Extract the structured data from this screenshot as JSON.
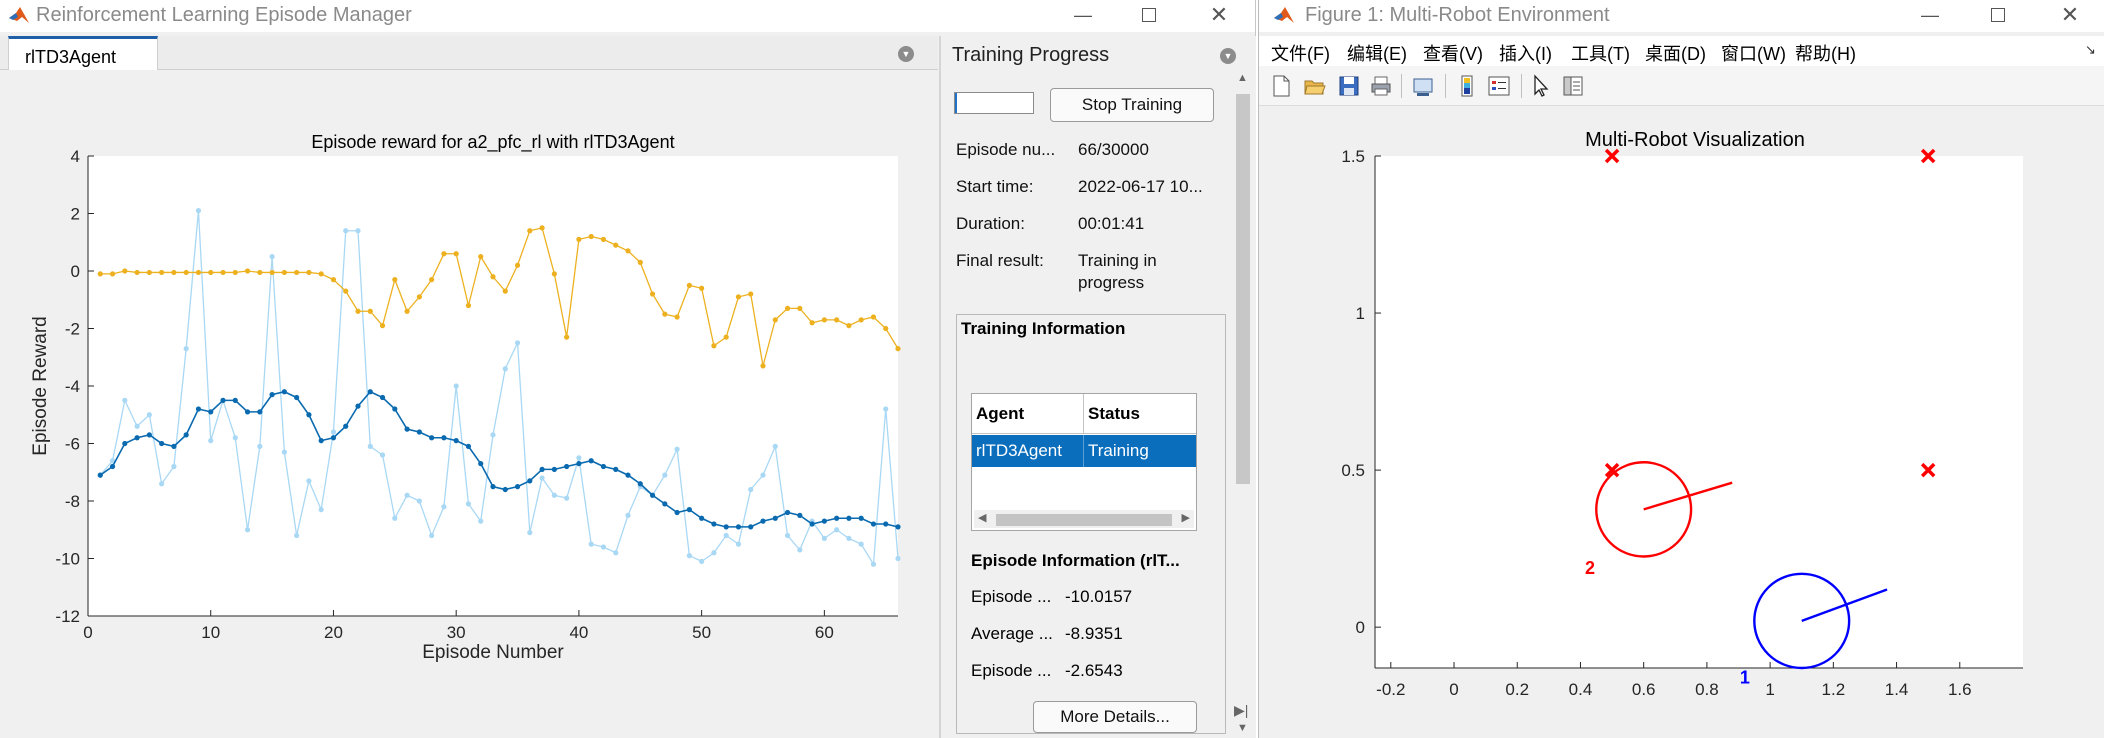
{
  "left_window": {
    "title": "Reinforcement Learning Episode Manager",
    "tab_label": "rlTD3Agent",
    "plot": {
      "title": "Episode reward for a2_pfc_rl with rlTD3Agent",
      "xlabel": "Episode Number",
      "ylabel": "Episode Reward",
      "xticks": [
        "0",
        "10",
        "20",
        "30",
        "40",
        "50",
        "60"
      ],
      "yticks": [
        "4",
        "2",
        "0",
        "-2",
        "-4",
        "-6",
        "-8",
        "-10",
        "-12"
      ]
    },
    "training_progress": {
      "title": "Training Progress",
      "progress_fraction": 0.0022,
      "stop_button": "Stop Training",
      "fields": [
        {
          "label": "Episode nu...",
          "value": "66/30000"
        },
        {
          "label": "Start time:",
          "value": "2022-06-17 10..."
        },
        {
          "label": "Duration:",
          "value": "00:01:41"
        },
        {
          "label": "Final result:",
          "value": "Training in",
          "value2": "progress"
        }
      ],
      "training_info_title": "Training Information",
      "table_headers": [
        "Agent",
        "Status"
      ],
      "table_row": [
        "rlTD3Agent",
        "Training"
      ],
      "episode_info_title": "Episode Information (rlT...",
      "episode_info": [
        {
          "label": "Episode ...",
          "value": "-10.0157"
        },
        {
          "label": "Average ...",
          "value": "-8.9351"
        },
        {
          "label": "Episode ...",
          "value": "-2.6543"
        }
      ],
      "more_button": "More Details..."
    }
  },
  "chart_data": [
    {
      "type": "line",
      "title": "Episode reward for a2_pfc_rl with rlTD3Agent",
      "xlabel": "Episode Number",
      "ylabel": "Episode Reward",
      "xlim": [
        0,
        66
      ],
      "ylim": [
        -12,
        4
      ],
      "series": [
        {
          "color": "#a9d8f5",
          "x": [
            1,
            2,
            3,
            4,
            5,
            6,
            7,
            8,
            9,
            10,
            11,
            12,
            13,
            14,
            15,
            16,
            17,
            18,
            19,
            20,
            21,
            22,
            23,
            24,
            25,
            26,
            27,
            28,
            29,
            30,
            31,
            32,
            33,
            34,
            35,
            36,
            37,
            38,
            39,
            40,
            41,
            42,
            43,
            44,
            45,
            46,
            47,
            48,
            49,
            50,
            51,
            52,
            53,
            54,
            55,
            56,
            57,
            58,
            59,
            60,
            61,
            62,
            63,
            64,
            65,
            66
          ],
          "values": [
            -7.1,
            -6.6,
            -4.5,
            -5.4,
            -5.0,
            -7.4,
            -6.8,
            -2.7,
            2.1,
            -5.9,
            -4.5,
            -5.8,
            -9.0,
            -6.1,
            0.5,
            -6.3,
            -9.2,
            -7.3,
            -8.3,
            -5.6,
            1.4,
            1.4,
            -6.1,
            -6.4,
            -8.6,
            -7.8,
            -8.0,
            -9.2,
            -8.2,
            -4.0,
            -8.1,
            -8.7,
            -5.7,
            -3.4,
            -2.5,
            -9.1,
            -7.2,
            -7.8,
            -7.9,
            -6.5,
            -9.5,
            -9.6,
            -9.8,
            -8.5,
            -7.5,
            -7.8,
            -7.1,
            -6.2,
            -9.9,
            -10.1,
            -9.8,
            -9.2,
            -9.5,
            -7.6,
            -7.1,
            -6.1,
            -9.2,
            -9.7,
            -8.7,
            -9.3,
            -9.0,
            -9.3,
            -9.5,
            -10.2,
            -4.8,
            -10.0
          ]
        },
        {
          "color": "#0a6ab0",
          "x": [
            1,
            2,
            3,
            4,
            5,
            6,
            7,
            8,
            9,
            10,
            11,
            12,
            13,
            14,
            15,
            16,
            17,
            18,
            19,
            20,
            21,
            22,
            23,
            24,
            25,
            26,
            27,
            28,
            29,
            30,
            31,
            32,
            33,
            34,
            35,
            36,
            37,
            38,
            39,
            40,
            41,
            42,
            43,
            44,
            45,
            46,
            47,
            48,
            49,
            50,
            51,
            52,
            53,
            54,
            55,
            56,
            57,
            58,
            59,
            60,
            61,
            62,
            63,
            64,
            65,
            66
          ],
          "values": [
            -7.1,
            -6.8,
            -6.0,
            -5.8,
            -5.7,
            -6.0,
            -6.1,
            -5.7,
            -4.8,
            -4.9,
            -4.5,
            -4.5,
            -4.9,
            -4.9,
            -4.3,
            -4.2,
            -4.4,
            -5.0,
            -5.9,
            -5.8,
            -5.4,
            -4.7,
            -4.2,
            -4.4,
            -4.8,
            -5.5,
            -5.6,
            -5.8,
            -5.8,
            -5.9,
            -6.1,
            -6.7,
            -7.5,
            -7.6,
            -7.5,
            -7.3,
            -6.9,
            -6.9,
            -6.8,
            -6.7,
            -6.6,
            -6.8,
            -6.9,
            -7.1,
            -7.4,
            -7.8,
            -8.1,
            -8.4,
            -8.3,
            -8.6,
            -8.8,
            -8.9,
            -8.9,
            -8.9,
            -8.7,
            -8.6,
            -8.4,
            -8.5,
            -8.8,
            -8.7,
            -8.6,
            -8.6,
            -8.6,
            -8.8,
            -8.8,
            -8.9
          ]
        },
        {
          "color": "#edb120",
          "x": [
            1,
            2,
            3,
            4,
            5,
            6,
            7,
            8,
            9,
            10,
            11,
            12,
            13,
            14,
            15,
            16,
            17,
            18,
            19,
            20,
            21,
            22,
            23,
            24,
            25,
            26,
            27,
            28,
            29,
            30,
            31,
            32,
            33,
            34,
            35,
            36,
            37,
            38,
            39,
            40,
            41,
            42,
            43,
            44,
            45,
            46,
            47,
            48,
            49,
            50,
            51,
            52,
            53,
            54,
            55,
            56,
            57,
            58,
            59,
            60,
            61,
            62,
            63,
            64,
            65,
            66
          ],
          "values": [
            -0.1,
            -0.1,
            0,
            -0.05,
            -0.05,
            -0.05,
            -0.05,
            -0.05,
            -0.05,
            -0.05,
            -0.05,
            -0.05,
            0,
            -0.05,
            -0.05,
            -0.05,
            -0.05,
            -0.05,
            -0.1,
            -0.3,
            -0.7,
            -1.4,
            -1.4,
            -1.9,
            -0.3,
            -1.4,
            -0.9,
            -0.3,
            0.6,
            0.6,
            -1.2,
            0.5,
            -0.2,
            -0.7,
            0.2,
            1.4,
            1.5,
            -0.1,
            -2.3,
            1.1,
            1.2,
            1.1,
            0.9,
            0.7,
            0.3,
            -0.8,
            -1.5,
            -1.6,
            -0.5,
            -0.6,
            -2.6,
            -2.3,
            -0.9,
            -0.8,
            -3.3,
            -1.7,
            -1.3,
            -1.3,
            -1.8,
            -1.7,
            -1.7,
            -1.9,
            -1.7,
            -1.6,
            -2.0,
            -2.7
          ]
        }
      ]
    },
    {
      "type": "scatter",
      "title": "Multi-Robot Visualization",
      "xlim": [
        -0.25,
        1.8
      ],
      "ylim": [
        -0.13,
        1.5
      ],
      "xticks": [
        "-0.2",
        "0",
        "0.2",
        "0.4",
        "0.6",
        "0.8",
        "1",
        "1.2",
        "1.4",
        "1.6"
      ],
      "yticks": [
        "1.5",
        "1",
        "0.5",
        "0"
      ],
      "targets": [
        [
          0.5,
          1.5
        ],
        [
          1.5,
          1.5
        ],
        [
          0.5,
          0.5
        ],
        [
          1.5,
          0.5
        ]
      ],
      "target_color": "#ff0000",
      "robots": [
        {
          "label": "2",
          "color": "#ff0000",
          "x": 0.6,
          "y": 0.375,
          "r": 0.15,
          "heading_to": [
            0.88,
            0.46
          ],
          "label_at": [
            0.43,
            0.17
          ]
        },
        {
          "label": "1",
          "color": "#0000ff",
          "x": 1.1,
          "y": 0.02,
          "r": 0.15,
          "heading_to": [
            1.37,
            0.12
          ],
          "label_at": [
            0.92,
            -0.18
          ]
        }
      ]
    }
  ],
  "right_window": {
    "title": "Figure 1: Multi-Robot Environment",
    "menu": [
      "文件(F)",
      "编辑(E)",
      "查看(V)",
      "插入(I)",
      "工具(T)",
      "桌面(D)",
      "窗口(W)",
      "帮助(H)"
    ]
  }
}
